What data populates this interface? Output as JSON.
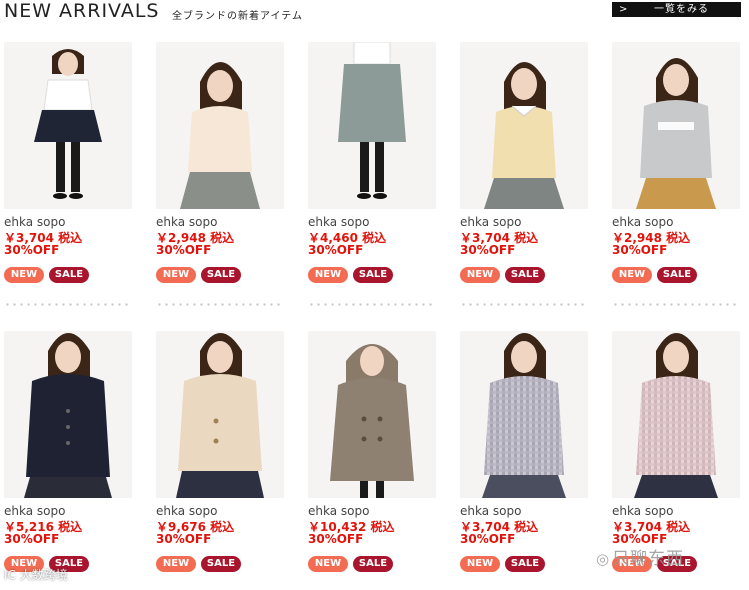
{
  "header": {
    "title": "NEW ARRIVALS",
    "subtitle": "全ブランドの新着アイテム",
    "view_all": "一覧をみる",
    "view_all_icon": "chevron-right-icon"
  },
  "badges": {
    "new": "NEW",
    "sale": "SALE"
  },
  "colors": {
    "price": "#e0140c",
    "badge_new": "#f26b52",
    "badge_sale": "#a9152d",
    "view_all_bg": "#111111"
  },
  "products_row1": [
    {
      "brand": "ehka sopo",
      "price": "￥3,704 税込",
      "discount": "30%OFF",
      "image": "model-navy-skirt-white-shirt"
    },
    {
      "brand": "ehka sopo",
      "price": "￥2,948 税込",
      "discount": "30%OFF",
      "image": "model-cream-knit-grey-skirt"
    },
    {
      "brand": "ehka sopo",
      "price": "￥4,460 税込",
      "discount": "30%OFF",
      "image": "model-grey-culottes"
    },
    {
      "brand": "ehka sopo",
      "price": "￥3,704 税込",
      "discount": "30%OFF",
      "image": "model-yellow-knit-collar"
    },
    {
      "brand": "ehka sopo",
      "price": "￥2,948 税込",
      "discount": "30%OFF",
      "image": "model-grey-merry-sweatshirt"
    }
  ],
  "products_row2": [
    {
      "brand": "ehka sopo",
      "price": "￥5,216 税込",
      "discount": "30%OFF",
      "image": "model-navy-knit-jacket"
    },
    {
      "brand": "ehka sopo",
      "price": "￥9,676 税込",
      "discount": "30%OFF",
      "image": "model-beige-wool-coat"
    },
    {
      "brand": "ehka sopo",
      "price": "￥10,432 税込",
      "discount": "30%OFF",
      "image": "model-taupe-hooded-coat"
    },
    {
      "brand": "ehka sopo",
      "price": "￥3,704 税込",
      "discount": "30%OFF",
      "image": "model-grey-check-blouse"
    },
    {
      "brand": "ehka sopo",
      "price": "￥3,704 税込",
      "discount": "30%OFF",
      "image": "model-pink-check-blouse"
    }
  ],
  "watermarks": {
    "left": "IC 大数跨境",
    "right": "只聊东西"
  }
}
